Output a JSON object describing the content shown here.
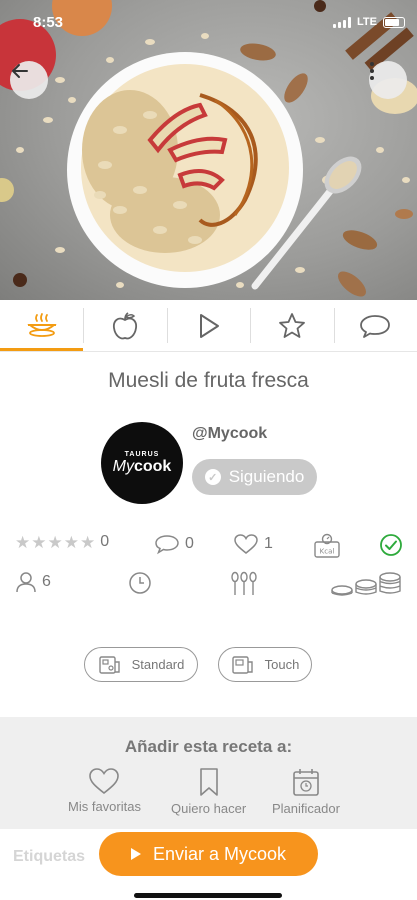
{
  "status_bar": {
    "time": "8:53",
    "network": "LTE"
  },
  "hero": {
    "image_alt": "bowl of muesli with apple slices and caramel"
  },
  "tabs": [
    {
      "name": "recipe",
      "icon": "cooking-pot-icon",
      "active": true
    },
    {
      "name": "ingredients",
      "icon": "apple-icon",
      "active": false
    },
    {
      "name": "video",
      "icon": "play-icon",
      "active": false
    },
    {
      "name": "rating",
      "icon": "star-icon",
      "active": false
    },
    {
      "name": "comments",
      "icon": "comment-icon",
      "active": false
    }
  ],
  "recipe": {
    "title": "Muesli de fruta fresca"
  },
  "author": {
    "username": "@Mycook",
    "logo_top": "TAURUS",
    "logo_main_a": "My",
    "logo_main_b": "cook",
    "follow_label": "Siguiendo"
  },
  "stats": {
    "rating_count": "0",
    "comments_count": "0",
    "likes_count": "1",
    "kcal_label": "Kcal",
    "servings": "6"
  },
  "modes": {
    "standard": "Standard",
    "touch": "Touch"
  },
  "add_to": {
    "title": "Añadir esta receta a:",
    "favorites": "Mis favoritas",
    "want_to_make": "Quiero hacer",
    "planner": "Planificador"
  },
  "tags_label": "Etiquetas",
  "send_button": "Enviar a Mycook",
  "colors": {
    "accent": "#f7941d",
    "active_tab": "#f39c12",
    "check_green": "#2eaa3c",
    "follow_bg": "#c9c9c9"
  }
}
